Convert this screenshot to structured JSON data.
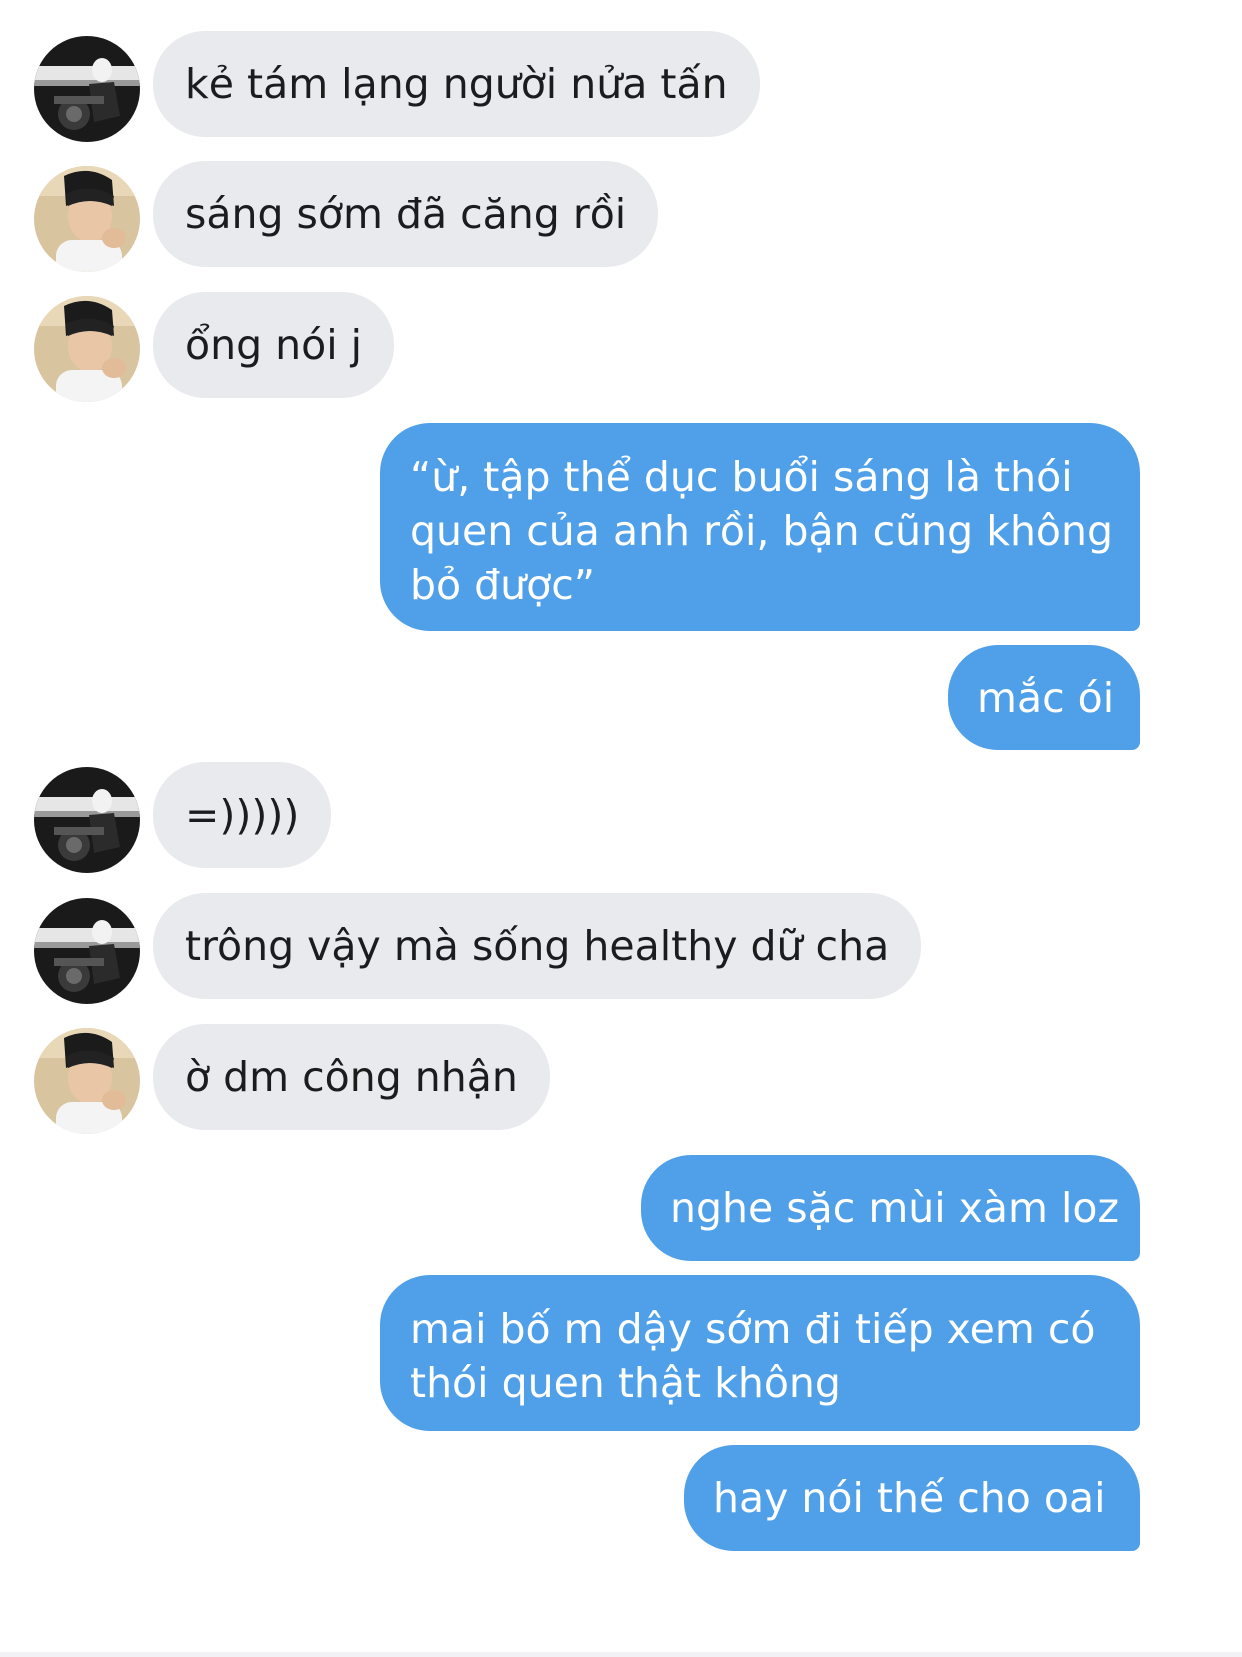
{
  "conversation": {
    "messages": [
      {
        "sender": "friend",
        "avatar": "dark-avatar",
        "text": "kẻ tám lạng người nửa tấn"
      },
      {
        "sender": "friend",
        "avatar": "beach-avatar",
        "text": "sáng sớm đã căng rồi"
      },
      {
        "sender": "friend",
        "avatar": "beach-avatar",
        "text": "ổng nói j"
      },
      {
        "sender": "me",
        "lines": [
          "“ừ, tập thể dục buổi sáng là thói",
          "quen của anh rồi, bận cũng không",
          "bỏ được”"
        ]
      },
      {
        "sender": "me",
        "text": "mắc ói"
      },
      {
        "sender": "friend",
        "avatar": "dark-avatar",
        "text": "=)))))"
      },
      {
        "sender": "friend",
        "avatar": "dark-avatar",
        "text": "trông vậy mà sống healthy dữ cha"
      },
      {
        "sender": "friend",
        "avatar": "beach-avatar",
        "text": "ờ dm công nhận"
      },
      {
        "sender": "me",
        "text": "nghe sặc mùi xàm loz"
      },
      {
        "sender": "me",
        "lines": [
          "mai bố m dậy sớm đi tiếp xem có",
          "thói quen thật không"
        ]
      },
      {
        "sender": "me",
        "text": "hay nói thế cho oai"
      }
    ]
  },
  "colors": {
    "incoming_bubble": "#e8eaee",
    "outgoing_bubble": "#4f9fe9",
    "incoming_text": "#1c1c1e",
    "outgoing_text": "#ffffff"
  }
}
